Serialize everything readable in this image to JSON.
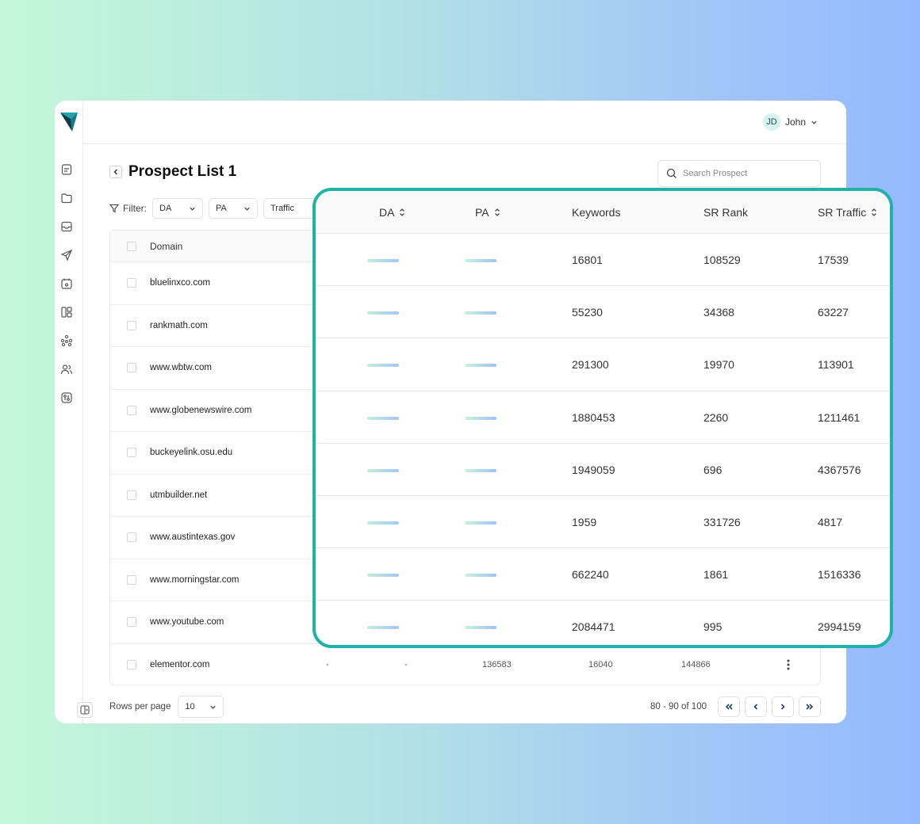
{
  "user": {
    "initials": "JD",
    "name": "John"
  },
  "page": {
    "title": "Prospect List 1"
  },
  "search": {
    "placeholder": "Search Prospect"
  },
  "filter": {
    "label": "Filter:",
    "selects": [
      {
        "label": "DA"
      },
      {
        "label": "PA"
      },
      {
        "label": "Traffic"
      }
    ]
  },
  "table": {
    "headers": {
      "domain": "Domain"
    },
    "rows": [
      {
        "domain": "bluelinxco.com"
      },
      {
        "domain": "rankmath.com"
      },
      {
        "domain": "www.wbtw.com"
      },
      {
        "domain": "www.globenewswire.com"
      },
      {
        "domain": "buckeyelink.osu.edu"
      },
      {
        "domain": "utmbuilder.net"
      },
      {
        "domain": "www.austintexas.gov"
      },
      {
        "domain": "www.morningstar.com"
      },
      {
        "domain": "www.youtube.com"
      },
      {
        "domain": "elementor.com",
        "da": "-",
        "pa": "-",
        "keywords": "136583",
        "sr_rank": "16040",
        "sr_traffic": "144866"
      }
    ]
  },
  "pagination": {
    "rows_per_page_label": "Rows per page",
    "rows_per_page_value": "10",
    "range": "80 - 90 of 100"
  },
  "overlay": {
    "headers": {
      "da": "DA",
      "pa": "PA",
      "keywords": "Keywords",
      "sr_rank": "SR Rank",
      "sr_traffic": "SR Traffic"
    },
    "rows": [
      {
        "keywords": "16801",
        "sr_rank": "108529",
        "sr_traffic": "17539"
      },
      {
        "keywords": "55230",
        "sr_rank": "34368",
        "sr_traffic": "63227"
      },
      {
        "keywords": "291300",
        "sr_rank": "19970",
        "sr_traffic": "113901"
      },
      {
        "keywords": "1880453",
        "sr_rank": "2260",
        "sr_traffic": "1211461"
      },
      {
        "keywords": "1949059",
        "sr_rank": "696",
        "sr_traffic": "4367576"
      },
      {
        "keywords": "1959",
        "sr_rank": "331726",
        "sr_traffic": "4817"
      },
      {
        "keywords": "662240",
        "sr_rank": "1861",
        "sr_traffic": "1516336"
      },
      {
        "keywords": "2084471",
        "sr_rank": "995",
        "sr_traffic": "2994159"
      }
    ]
  },
  "colors": {
    "accent": "#1fb3a8",
    "brand_logo": "#1a8f9a"
  }
}
